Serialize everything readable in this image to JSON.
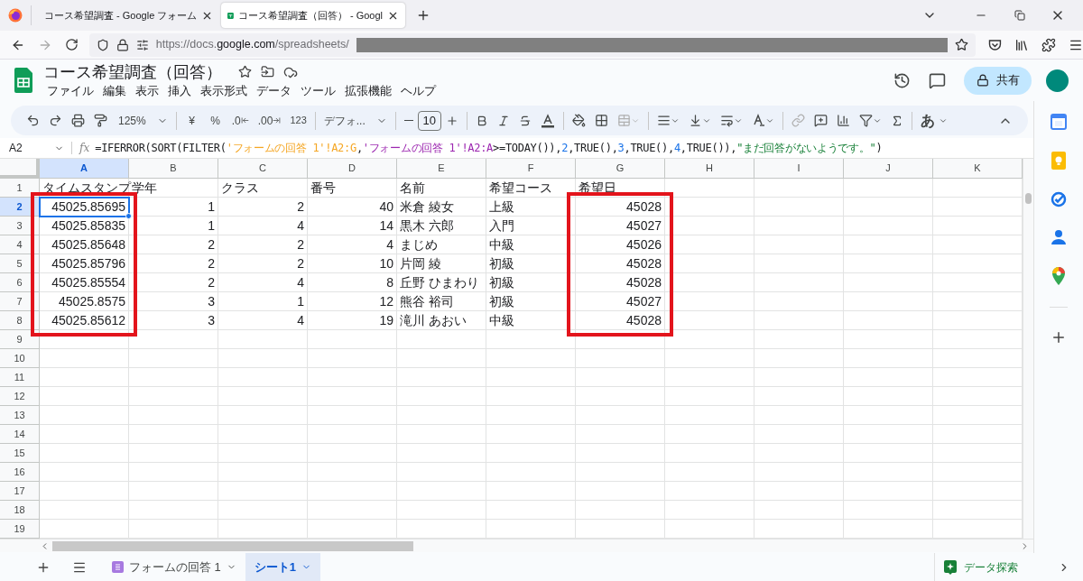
{
  "browser_tabs": [
    {
      "title": "コース希望調査 - Google フォーム",
      "selected": false
    },
    {
      "title": "コース希望調査（回答） - Googl",
      "selected": true
    }
  ],
  "url_parts": [
    {
      "kind": "dim",
      "text": "https://docs."
    },
    {
      "kind": "host",
      "text": "google.com"
    },
    {
      "kind": "dim",
      "text": "/spreadsheets/"
    }
  ],
  "doc_title": "コース希望調査（回答）",
  "menu": [
    "ファイル",
    "編集",
    "表示",
    "挿入",
    "表示形式",
    "データ",
    "ツール",
    "拡張機能",
    "ヘルプ"
  ],
  "share_button": "共有",
  "toolbar": {
    "zoom": "125%",
    "currency": "¥",
    "percent": "%",
    "decrease_decimals": ".0",
    "increase_decimals": ".00",
    "number_format": "123",
    "font": "デフォ...",
    "font_size": "10",
    "input_tool": "あ"
  },
  "name_box": "A2",
  "fx_label": "fx",
  "formula": [
    {
      "kind": "plain",
      "text": "=IFERROR(SORT(FILTER("
    },
    {
      "kind": "range1",
      "text": "'フォームの回答 1'!A2:G"
    },
    {
      "kind": "plain",
      "text": ","
    },
    {
      "kind": "range2",
      "text": "'フォームの回答 1'!A2:A"
    },
    {
      "kind": "plain",
      "text": ">=TODAY()),"
    },
    {
      "kind": "number",
      "text": "2"
    },
    {
      "kind": "plain",
      "text": ",TRUE(),"
    },
    {
      "kind": "number",
      "text": "3"
    },
    {
      "kind": "plain",
      "text": ",TRUE(),"
    },
    {
      "kind": "number",
      "text": "4"
    },
    {
      "kind": "plain",
      "text": ",TRUE()),"
    },
    {
      "kind": "string",
      "text": "\"まだ回答がないようです。\""
    },
    {
      "kind": "plain",
      "text": ")"
    }
  ],
  "columns": [
    {
      "label": "A",
      "selected": true,
      "numeric": true,
      "framed": true
    },
    {
      "label": "B",
      "selected": false,
      "numeric": true,
      "framed": false
    },
    {
      "label": "C",
      "selected": false,
      "numeric": true,
      "framed": false
    },
    {
      "label": "D",
      "selected": false,
      "numeric": true,
      "framed": false
    },
    {
      "label": "E",
      "selected": false,
      "numeric": false,
      "framed": false
    },
    {
      "label": "F",
      "selected": false,
      "numeric": false,
      "framed": false
    },
    {
      "label": "G",
      "selected": false,
      "numeric": true,
      "framed": true
    },
    {
      "label": "H",
      "selected": false,
      "framed": false
    },
    {
      "label": "I",
      "selected": false,
      "framed": false
    },
    {
      "label": "J",
      "selected": false,
      "framed": false
    },
    {
      "label": "K",
      "selected": false,
      "framed": false
    }
  ],
  "rows": [
    {
      "number": "1",
      "kind": "header",
      "selected": false,
      "cells": [
        "タイムスタンプ",
        "学年",
        "クラス",
        "番号",
        "名前",
        "希望コース",
        "希望日"
      ]
    },
    {
      "number": "2",
      "kind": "data",
      "selected": true,
      "cells": [
        "45025.85695",
        "1",
        "2",
        "40",
        "米倉 綾女",
        "上級",
        "45028"
      ]
    },
    {
      "number": "3",
      "kind": "data",
      "selected": false,
      "cells": [
        "45025.85835",
        "1",
        "4",
        "14",
        "黒木 六郎",
        "入門",
        "45027"
      ]
    },
    {
      "number": "4",
      "kind": "data",
      "selected": false,
      "cells": [
        "45025.85648",
        "2",
        "2",
        "4",
        "まじめ",
        "中級",
        "45026"
      ]
    },
    {
      "number": "5",
      "kind": "data",
      "selected": false,
      "cells": [
        "45025.85796",
        "2",
        "2",
        "10",
        "片岡 綾",
        "初級",
        "45028"
      ]
    },
    {
      "number": "6",
      "kind": "data",
      "selected": false,
      "cells": [
        "45025.85554",
        "2",
        "4",
        "8",
        "丘野 ひまわり",
        "初級",
        "45028"
      ]
    },
    {
      "number": "7",
      "kind": "data",
      "selected": false,
      "cells": [
        "45025.8575",
        "3",
        "1",
        "12",
        "熊谷 裕司",
        "初級",
        "45027"
      ]
    },
    {
      "number": "8",
      "kind": "data",
      "selected": false,
      "cells": [
        "45025.85612",
        "3",
        "4",
        "19",
        "滝川 あおい",
        "中級",
        "45028"
      ]
    },
    {
      "number": "9",
      "kind": "data",
      "selected": false,
      "cells": []
    },
    {
      "number": "10",
      "kind": "data",
      "selected": false,
      "cells": []
    },
    {
      "number": "11",
      "kind": "data",
      "selected": false,
      "cells": []
    },
    {
      "number": "12",
      "kind": "data",
      "selected": false,
      "cells": []
    },
    {
      "number": "13",
      "kind": "data",
      "selected": false,
      "cells": []
    },
    {
      "number": "14",
      "kind": "data",
      "selected": false,
      "cells": []
    },
    {
      "number": "15",
      "kind": "data",
      "selected": false,
      "cells": []
    },
    {
      "number": "16",
      "kind": "data",
      "selected": false,
      "cells": []
    },
    {
      "number": "17",
      "kind": "data",
      "selected": false,
      "cells": []
    },
    {
      "number": "18",
      "kind": "data",
      "selected": false,
      "cells": []
    },
    {
      "number": "19",
      "kind": "data",
      "selected": false,
      "cells": []
    }
  ],
  "sheet_tabs": [
    {
      "label": "フォームの回答 1",
      "selected": false,
      "kind": "form"
    },
    {
      "label": "シート1",
      "selected": true,
      "kind": "plain"
    }
  ],
  "explore_button": "データ探索"
}
